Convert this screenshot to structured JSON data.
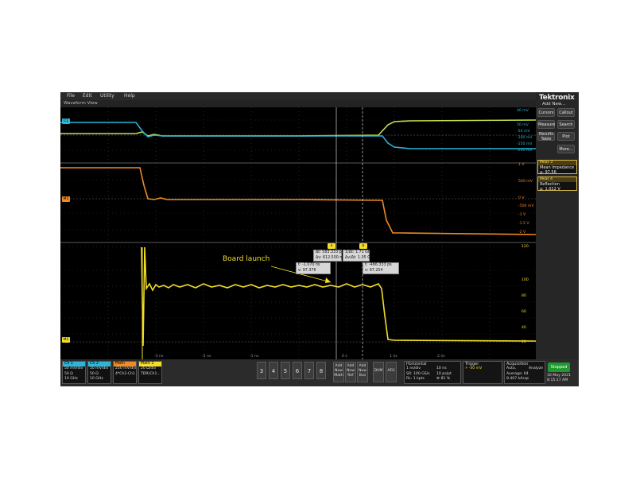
{
  "app": {
    "logo": "Tektronix",
    "add_new": "Add New..."
  },
  "menu": [
    "File",
    "Edit",
    "Utility",
    "Help"
  ],
  "waveform_view": {
    "title": "Waveform View"
  },
  "right_buttons": [
    {
      "label": "Cursors",
      "name": "cursors-button"
    },
    {
      "label": "Callout",
      "name": "callout-button"
    },
    {
      "label": "Measure",
      "name": "measure-button"
    },
    {
      "label": "Search",
      "name": "search-button"
    },
    {
      "label": "Results Table",
      "name": "results-table-button"
    },
    {
      "label": "Plot",
      "name": "plot-button"
    },
    {
      "label": "More...",
      "name": "more-button"
    }
  ],
  "measurements": [
    {
      "title": "Meas 3",
      "name": "Mean Impedance",
      "value": "μ: 97.56"
    },
    {
      "title": "Meas 4",
      "name": "Reflection",
      "value": "μ: 1.022 V"
    }
  ],
  "annotation": "Board launch",
  "cursor_readouts": [
    {
      "l1": "Δt: 583.333 ps",
      "l2": "Δv: 612.500 m"
    },
    {
      "l1": "1/Δt: 1.71 GHz",
      "l2": "Δv/Δt: 1.05 G/s"
    },
    {
      "l1": "t: -1.070 ns",
      "l2": "v: 97.376"
    },
    {
      "l1": "t: -486.333 ps",
      "l2": "v: 97.254"
    }
  ],
  "cursor_tags": [
    "a",
    "b",
    "a",
    "b"
  ],
  "channels": [
    {
      "title": "Ch 1",
      "lines": [
        "50 mV/div",
        "50 Ω",
        "10 GHz"
      ],
      "color": "#29b6d8"
    },
    {
      "title": "Ch 2",
      "lines": [
        "50 mV/div",
        "50 Ω",
        "10 GHz"
      ],
      "color": "#29b6d8"
    },
    {
      "title": "Math",
      "lines": [
        "250 mV/div",
        "4*Ch2-Ch1"
      ],
      "color": "#f08a24"
    },
    {
      "title": "Math 2",
      "lines": [
        "20 Ω/div",
        "TDR(Ch1..."
      ],
      "color": "#f2de2a"
    }
  ],
  "number_buttons": [
    "3",
    "4",
    "5",
    "6",
    "7",
    "8"
  ],
  "add_buttons": [
    {
      "l1": "Add",
      "l2": "New",
      "l3": "Math"
    },
    {
      "l1": "Add",
      "l2": "New",
      "l3": "Ref"
    },
    {
      "l1": "Add",
      "l2": "New",
      "l3": "Bus"
    }
  ],
  "tool_buttons": [
    "DVM",
    "AFG"
  ],
  "horizontal": {
    "title": "Horizontal",
    "lines": [
      "1 ns/div",
      "SR: 100 GS/s",
      "RL: 1 kpts"
    ],
    "right_lines": [
      "10 ns",
      "10 ps/pt",
      "⚙ 81 %"
    ]
  },
  "trigger": {
    "title": "Trigger",
    "lines": [
      "⚡ -40 mV"
    ]
  },
  "acquisition": {
    "title": "Acquisition",
    "lines": [
      "Auto,",
      "Average: 64",
      "8.407 kAcqs"
    ],
    "right_lines": [
      "Analyze",
      ""
    ]
  },
  "run_state": {
    "label": "Stopped"
  },
  "datetime": {
    "date": "16 May 2021",
    "time": "8:15:17 AM"
  },
  "time_ticks": [
    "-3 ns",
    "-2 ns",
    "-1 ns",
    "0 s",
    "1 ns",
    "2 ns"
  ],
  "scale_labels": {
    "top": [
      "40 mV",
      "50 mV",
      "-50 mV",
      "-100 mV",
      "-150 mV",
      "-200 mV"
    ],
    "mid": [
      "1 V",
      "500 mV",
      "0 V",
      "-500 mV",
      "-1 V",
      "-1.5 V",
      "-2 V"
    ],
    "bot": [
      "120",
      "100",
      "80",
      "60",
      "40",
      "20"
    ]
  },
  "colors": {
    "ch1": "#29b6d8",
    "ch2": "#c6e04a",
    "math": "#f08a24",
    "tdr": "#f2de2a",
    "stopped": "#1f9a2f"
  }
}
